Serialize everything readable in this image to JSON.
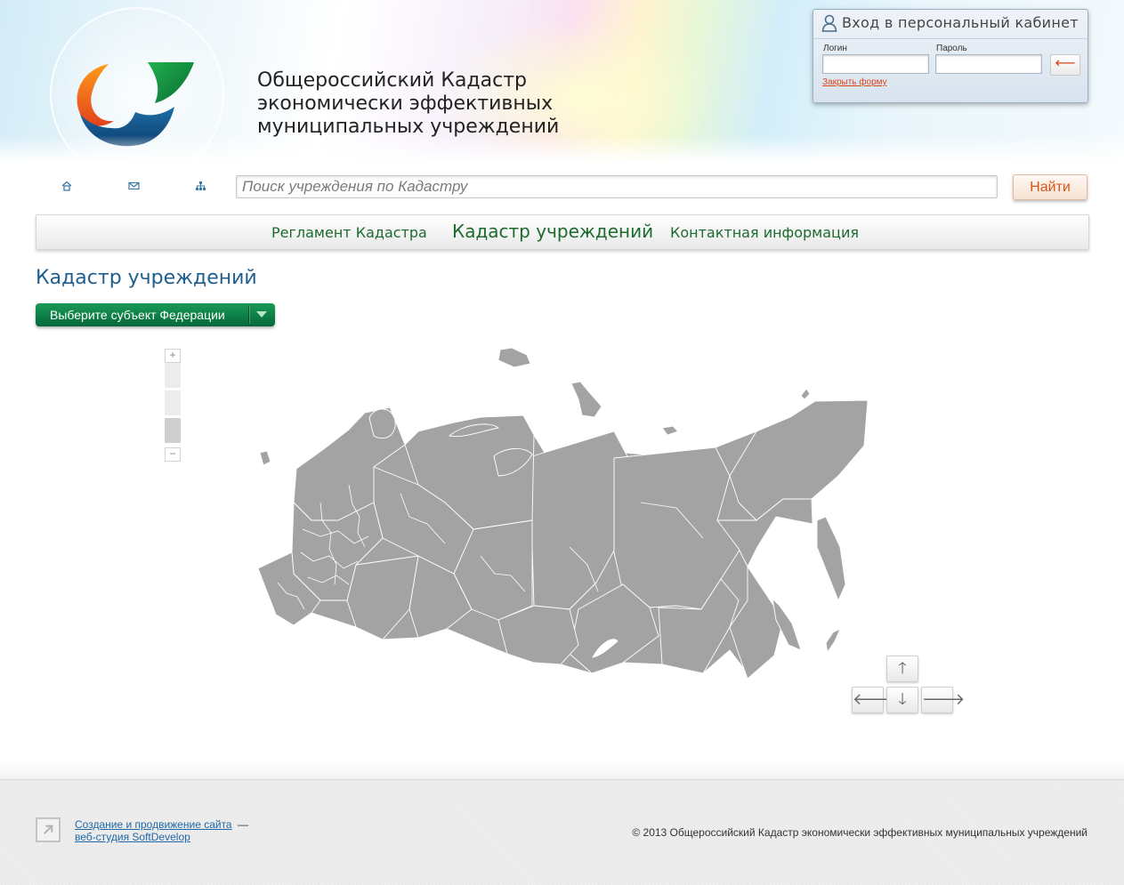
{
  "header": {
    "title_lines": [
      "Общероссийский Кадастр",
      "экономически эффективных",
      "муниципальных учреждений"
    ],
    "login": {
      "title": "Вход в персональный кабинет",
      "login_label": "Логин",
      "password_label": "Пароль",
      "login_value": "",
      "password_value": "",
      "submit_icon": "return-arrow-icon",
      "close_link": "Закрыть форму"
    }
  },
  "toolbar": {
    "icons": [
      "home-icon",
      "mail-icon",
      "sitemap-icon"
    ],
    "search_placeholder": "Поиск учреждения по Кадастру",
    "search_value": "",
    "search_button": "Найти"
  },
  "menu": {
    "items": [
      {
        "label": "Регламент Кадастра",
        "active": false
      },
      {
        "label": "Кадастр учреждений",
        "active": true
      },
      {
        "label": "Контактная информация",
        "active": false
      }
    ]
  },
  "main": {
    "page_title": "Кадастр учреждений",
    "subject_select": "Выберите субъект Федерации",
    "zoom": {
      "plus": "+",
      "minus": "−",
      "levels": 3,
      "current_level": 3
    },
    "map_region_color": "#a3a3a3",
    "pan": {
      "up": "🡑",
      "left": "🡐",
      "down": "🡓",
      "right": "🡒"
    }
  },
  "footer": {
    "dev_link_1": "Создание и продвижение сайта",
    "dev_dash": "—",
    "dev_link_2": "веб-студия SoftDevelop",
    "copyright": "© 2013 Общероссийский Кадастр экономически эффективных муниципальных учреждений"
  },
  "colors": {
    "accent_green": "#05683a",
    "link_blue": "#1f67a6",
    "title_blue": "#1f5f8f",
    "orange": "#d9561a"
  }
}
